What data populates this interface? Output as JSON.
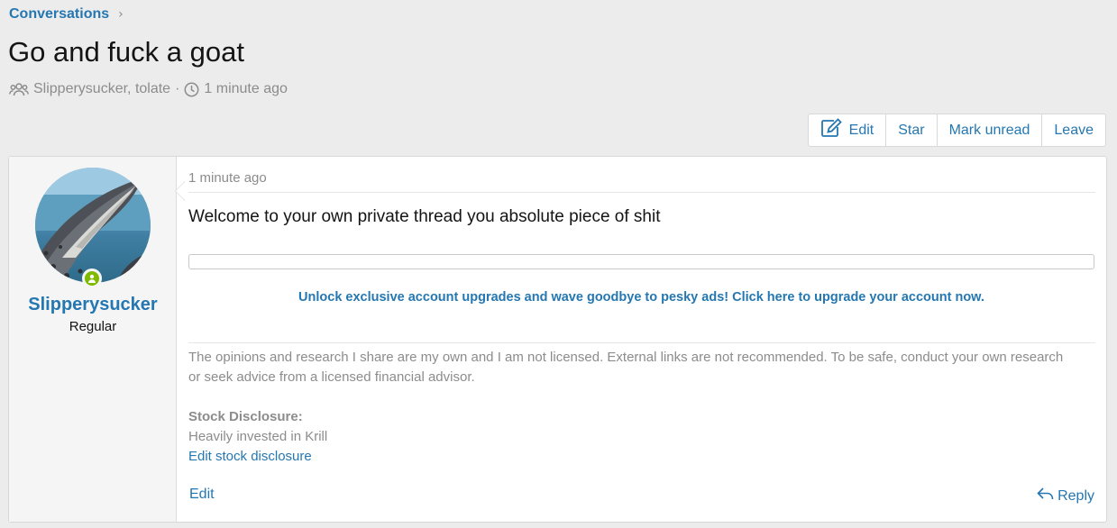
{
  "breadcrumb": {
    "label": "Conversations",
    "chevron": "›"
  },
  "conversation": {
    "title": "Go and fuck a goat",
    "participants": "Slipperysucker, tolate",
    "separator": "·",
    "time": "1 minute ago"
  },
  "actions": {
    "edit": "Edit",
    "star": "Star",
    "mark_unread": "Mark unread",
    "leave": "Leave"
  },
  "message": {
    "author": "Slipperysucker",
    "user_title": "Regular",
    "time": "1 minute ago",
    "body": "Welcome to your own private thread you absolute piece of shit",
    "promo": "Unlock exclusive account upgrades and wave goodbye to pesky ads! Click here to upgrade your account now.",
    "signature": {
      "disclaimer": "The opinions and research I share are my own and I am not licensed. External links are not recommended. To be safe, conduct your own research or seek advice from a licensed financial advisor.",
      "stock_label": "Stock Disclosure:",
      "stock_value": "Heavily invested in Krill",
      "edit_link": "Edit stock disclosure"
    },
    "edit_label": "Edit",
    "reply_label": "Reply"
  },
  "colors": {
    "link": "#2577b1",
    "muted": "#8c8c8c",
    "online": "#7fb900",
    "background": "#ececec"
  },
  "icons": {
    "participants": "users-icon",
    "time": "clock-icon",
    "edit": "edit-icon",
    "reply": "reply-icon",
    "online": "online-status-icon"
  }
}
